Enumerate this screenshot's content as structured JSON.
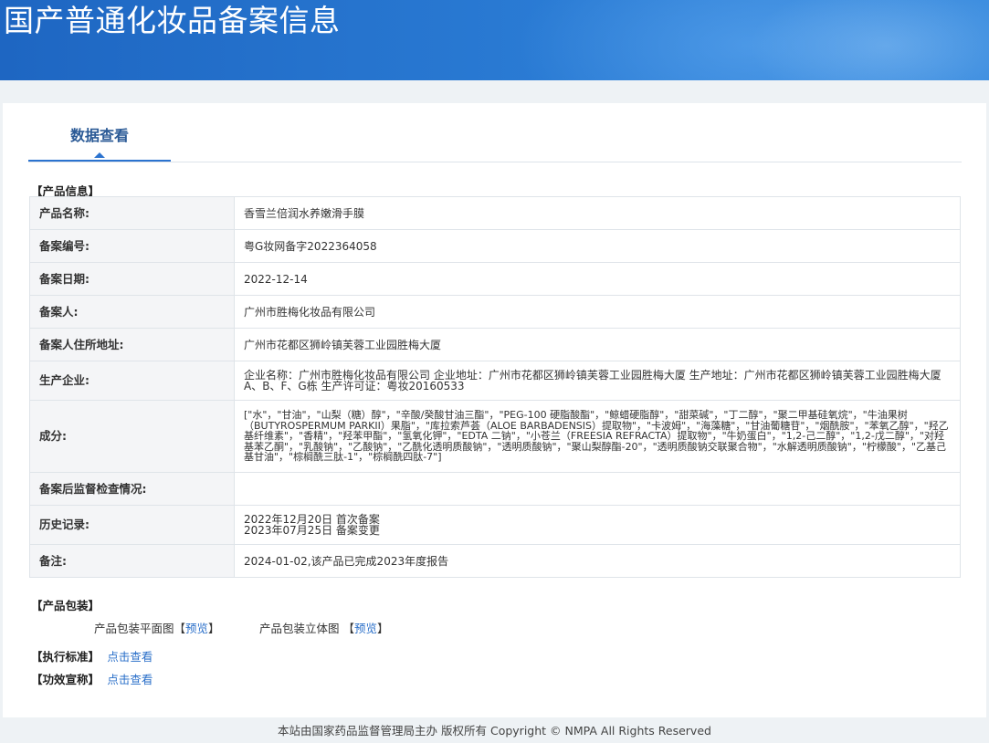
{
  "header": {
    "title": "国产普通化妆品备案信息"
  },
  "tab": {
    "label": "数据查看"
  },
  "product_info": {
    "section_label": "【产品信息】",
    "rows": [
      {
        "key": "产品名称:",
        "value": "香雪兰倍润水养嫩滑手膜"
      },
      {
        "key": "备案编号:",
        "value": "粤G妆网备字2022364058"
      },
      {
        "key": "备案日期:",
        "value": "2022-12-14"
      },
      {
        "key": "备案人:",
        "value": "广州市胜梅化妆品有限公司"
      },
      {
        "key": "备案人住所地址:",
        "value": "广州市花都区狮岭镇芙蓉工业园胜梅大厦"
      },
      {
        "key": "生产企业:",
        "value": "企业名称：广州市胜梅化妆品有限公司 企业地址：广州市花都区狮岭镇芙蓉工业园胜梅大厦 生产地址：广州市花都区狮岭镇芙蓉工业园胜梅大厦A、B、F、G栋 生产许可证：粤妆20160533"
      },
      {
        "key": "成分:",
        "value": "[\"水\"，\"甘油\"，\"山梨（糖）醇\"，\"辛酸/癸酸甘油三酯\"，\"PEG-100 硬脂酸酯\"，\"鲸蜡硬脂醇\"，\"甜菜碱\"，\"丁二醇\"，\"聚二甲基硅氧烷\"，\"牛油果树（BUTYROSPERMUM PARKII）果脂\"，\"库拉索芦荟（ALOE BARBADENSIS）提取物\"，\"卡波姆\"，\"海藻糖\"，\"甘油葡糖苷\"，\"烟酰胺\"，\"苯氧乙醇\"，\"羟乙基纤维素\"，\"香精\"，\"羟苯甲酯\"，\"氢氧化钾\"，\"EDTA 二钠\"，\"小苍兰（FREESIA REFRACTA）提取物\"，\"牛奶蛋白\"，\"1,2-己二醇\"，\"1,2-戊二醇\"，\"对羟基苯乙酮\"，\"乳酸钠\"，\"乙酸钠\"，\"乙酰化透明质酸钠\"，\"透明质酸钠\"，\"聚山梨醇酯-20\"，\"透明质酸钠交联聚合物\"，\"水解透明质酸钠\"，\"柠檬酸\"，\"乙基己基甘油\"，\"棕榈酰三肽-1\"，\"棕榈酰四肽-7\"]"
      },
      {
        "key": "备案后监督检查情况:",
        "value": ""
      },
      {
        "key": "历史记录:",
        "value": "",
        "lines": [
          "2022年12月20日 首次备案",
          "2023年07月25日 备案变更"
        ]
      },
      {
        "key": "备注:",
        "value": "2024-01-02,该产品已完成2023年度报告"
      }
    ]
  },
  "packaging": {
    "section_label": "【产品包装】",
    "flat": {
      "label": "产品包装平面图",
      "link": "预览"
    },
    "solid": {
      "label": "产品包装立体图",
      "link": "预览"
    }
  },
  "standard": {
    "label": "【执行标准】",
    "link": "点击查看"
  },
  "efficacy": {
    "label": "【功效宣称】",
    "link": "点击查看"
  },
  "footer": {
    "text": "本站由国家药品监督管理局主办 版权所有 Copyright © NMPA All Rights Reserved"
  }
}
